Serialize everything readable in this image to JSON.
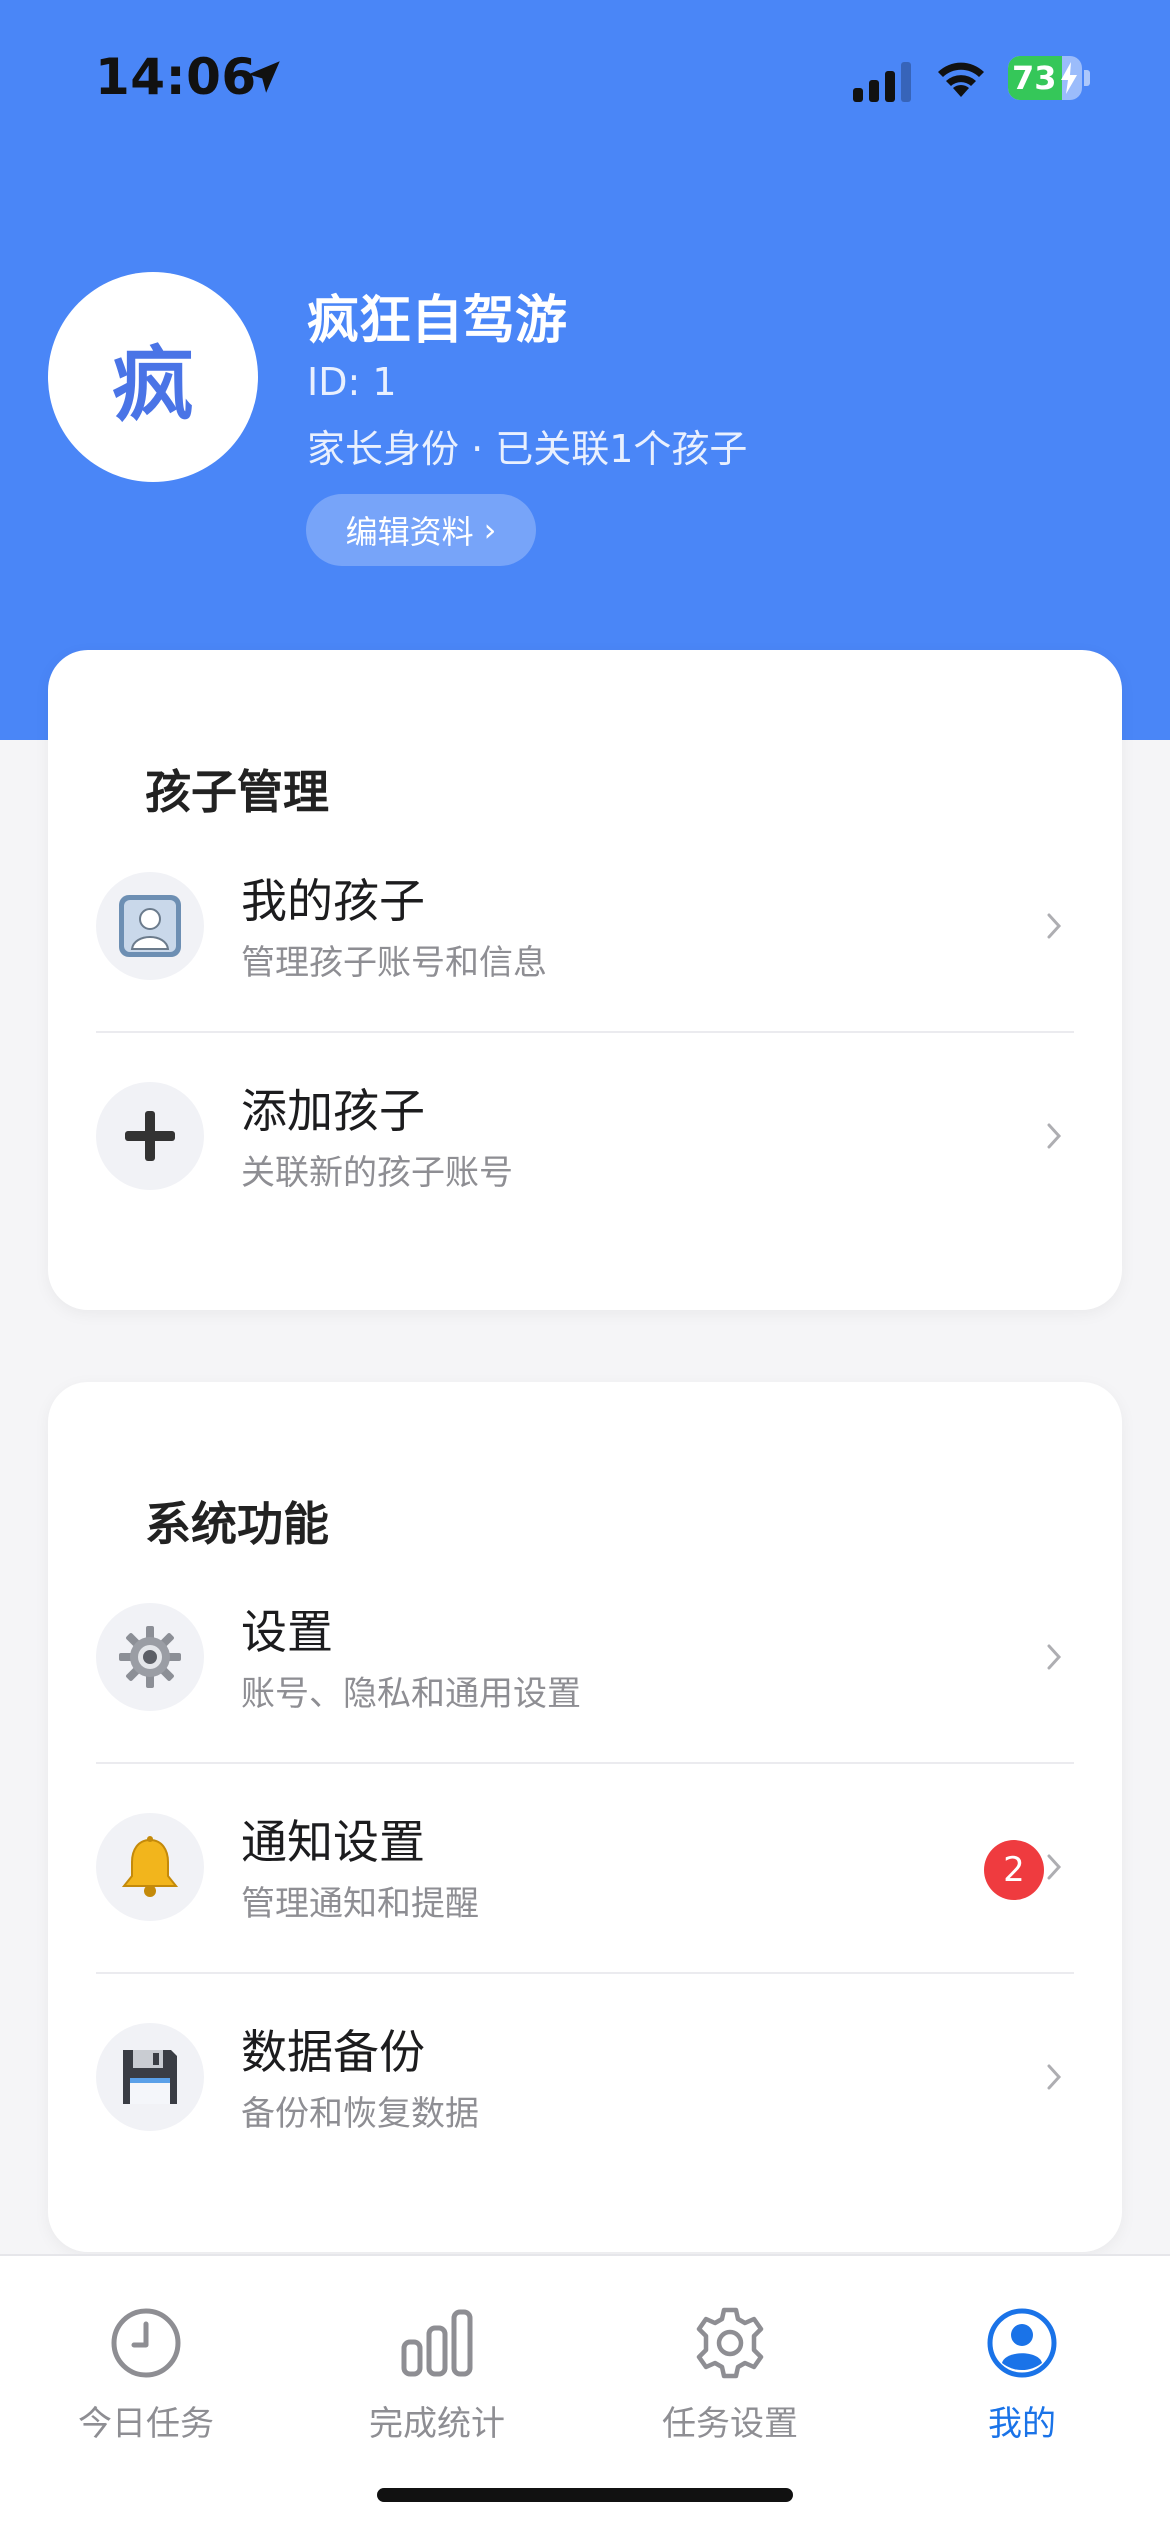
{
  "status_bar": {
    "time": "14:06",
    "battery_level": "73",
    "battery_fraction": 0.73,
    "icons": [
      "location-arrow-icon",
      "cellular-signal-icon",
      "wifi-icon",
      "battery-charging-icon"
    ]
  },
  "profile": {
    "avatar_char": "疯",
    "name": "疯狂自驾游",
    "id": "ID: 1",
    "role": "家长身份 · 已关联1个孩子",
    "edit_label": "编辑资料",
    "edit_chevron": "›"
  },
  "sections": [
    {
      "title": "孩子管理",
      "items": [
        {
          "icon": "child-portrait-icon",
          "title": "我的孩子",
          "subtitle": "管理孩子账号和信息",
          "chevron": "›"
        },
        {
          "icon": "plus-icon",
          "title": "添加孩子",
          "subtitle": "关联新的孩子账号",
          "chevron": "›"
        }
      ]
    },
    {
      "title": "系统功能",
      "items": [
        {
          "icon": "gear-icon",
          "title": "设置",
          "subtitle": "账号、隐私和通用设置",
          "chevron": "›"
        },
        {
          "icon": "bell-icon",
          "title": "通知设置",
          "subtitle": "管理通知和提醒",
          "badge": "2",
          "chevron": "›"
        },
        {
          "icon": "floppy-disk-icon",
          "title": "数据备份",
          "subtitle": "备份和恢复数据",
          "chevron": "›"
        }
      ]
    }
  ],
  "tabbar": {
    "tabs": [
      {
        "icon": "clock-icon",
        "label": "今日任务",
        "active": false
      },
      {
        "icon": "bar-chart-icon",
        "label": "完成统计",
        "active": false
      },
      {
        "icon": "settings-gear-icon",
        "label": "任务设置",
        "active": false
      },
      {
        "icon": "profile-icon",
        "label": "我的",
        "active": true
      }
    ]
  },
  "colors": {
    "header_bg": "#4a86f7",
    "accent": "#1a73e8",
    "badge_red": "#ef3b3f",
    "battery_green": "#35c759"
  }
}
